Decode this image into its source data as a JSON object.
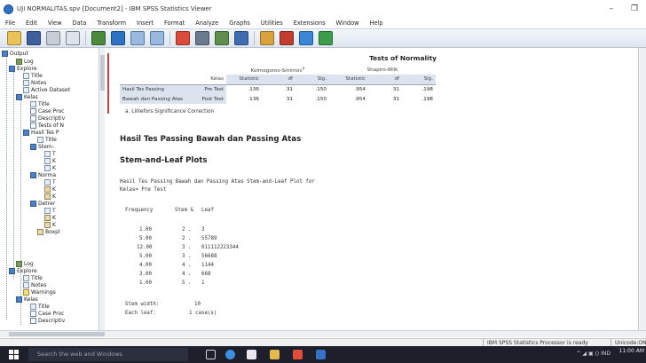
{
  "window": {
    "title": "UJI NORMALITAS.spv [Document2] - IBM SPSS Statistics Viewer",
    "minimize": "–",
    "restore": "❐"
  },
  "menu": [
    "File",
    "Edit",
    "View",
    "Data",
    "Transform",
    "Insert",
    "Format",
    "Analyze",
    "Graphs",
    "Utilities",
    "Extensions",
    "Window",
    "Help"
  ],
  "navigator": {
    "items": [
      {
        "label": "Output",
        "icon": "output-book-icon"
      },
      {
        "label": "Log",
        "icon": "log-icon"
      },
      {
        "label": "Explore",
        "icon": "explore-book-icon"
      },
      {
        "label": "Title",
        "icon": "title-icon"
      },
      {
        "label": "Notes",
        "icon": "notes-icon"
      },
      {
        "label": "Active Dataset",
        "icon": "dataset-icon"
      },
      {
        "label": "Kelas",
        "icon": "folder-book-icon"
      },
      {
        "label": "Title",
        "icon": "title-icon"
      },
      {
        "label": "Case Proc",
        "icon": "table-icon"
      },
      {
        "label": "Descriptiv",
        "icon": "table-icon"
      },
      {
        "label": "Tests of N",
        "icon": "table-icon"
      },
      {
        "label": "Hasil Tes P",
        "icon": "folder-book-icon"
      },
      {
        "label": "Title",
        "icon": "title-icon"
      },
      {
        "label": "Stem-",
        "icon": "folder-book-icon"
      },
      {
        "label": "T",
        "icon": "title-icon"
      },
      {
        "label": "K",
        "icon": "text-icon"
      },
      {
        "label": "K",
        "icon": "text-icon"
      },
      {
        "label": "Norma",
        "icon": "folder-book-icon"
      },
      {
        "label": "T",
        "icon": "title-icon"
      },
      {
        "label": "K",
        "icon": "chart-icon"
      },
      {
        "label": "K",
        "icon": "chart-icon"
      },
      {
        "label": "Detrer",
        "icon": "folder-book-icon"
      },
      {
        "label": "T",
        "icon": "title-icon"
      },
      {
        "label": "K",
        "icon": "chart-icon"
      },
      {
        "label": "K",
        "icon": "chart-icon"
      },
      {
        "label": "Boxpl",
        "icon": "chart-icon"
      },
      {
        "label": "Log",
        "icon": "log-icon"
      },
      {
        "label": "Explore",
        "icon": "explore-book-icon"
      },
      {
        "label": "Title",
        "icon": "title-icon"
      },
      {
        "label": "Notes",
        "icon": "notes-icon"
      },
      {
        "label": "Warnings",
        "icon": "warning-icon"
      },
      {
        "label": "Kelas",
        "icon": "folder-book-icon"
      },
      {
        "label": "Title",
        "icon": "title-icon"
      },
      {
        "label": "Case Proc",
        "icon": "table-icon"
      },
      {
        "label": "Descriptiv",
        "icon": "table-icon"
      }
    ]
  },
  "normality_table": {
    "title": "Tests of Normality",
    "ks_header": "Kolmogorov-Smirnov",
    "ks_sup": "a",
    "sw_header": "Shapiro-Wilk",
    "col_kelas": "Kelas",
    "cols": [
      "Statistic",
      "df",
      "Sig.",
      "Statistic",
      "df",
      "Sig."
    ],
    "row_label_1": "Hasil Tes Passing",
    "row_label_2": "Bawah dan Passing Atas",
    "rows": [
      {
        "kelas": "Pre Test",
        "values": [
          ".136",
          "31",
          ".150",
          ".954",
          "31",
          ".198"
        ]
      },
      {
        "kelas": "Post Test",
        "values": [
          ".136",
          "31",
          ".150",
          ".954",
          "31",
          ".198"
        ]
      }
    ],
    "footnote": "a. Lilliefors Significance Correction"
  },
  "heading_var": "Hasil Tes Passing Bawah dan Passing Atas",
  "heading_stem": "Stem-and-Leaf Plots",
  "stemleaf": {
    "caption": "Hasil Tes Passing Bawah dan Passing Atas Stem-and-Leaf Plot for",
    "group": "Kelas= Pre Test",
    "col_freq": "Frequency",
    "col_stem": "Stem &",
    "col_leaf": "Leaf",
    "rows": [
      {
        "freq": "1.00",
        "stem": "2 .",
        "leaf": "3"
      },
      {
        "freq": "5.00",
        "stem": "2 .",
        "leaf": "55789"
      },
      {
        "freq": "12.00",
        "stem": "3 .",
        "leaf": "011112223344"
      },
      {
        "freq": "5.00",
        "stem": "3 .",
        "leaf": "56688"
      },
      {
        "freq": "4.00",
        "stem": "4 .",
        "leaf": "1144"
      },
      {
        "freq": "3.00",
        "stem": "4 .",
        "leaf": "668"
      },
      {
        "freq": "1.00",
        "stem": "5 .",
        "leaf": "1"
      }
    ],
    "stem_width_label": "Stem width:",
    "stem_width": "10",
    "each_leaf_label": "Each leaf:",
    "each_leaf": "1 case(s)"
  },
  "status": {
    "processor": "IBM SPSS Statistics Processor is ready",
    "unicode": "Unicode:ON"
  },
  "taskbar": {
    "search_placeholder": "Search the web and Windows",
    "tray": "^ ◢ ▣ ⟨⟩ IND",
    "time": "11:00 AM"
  }
}
